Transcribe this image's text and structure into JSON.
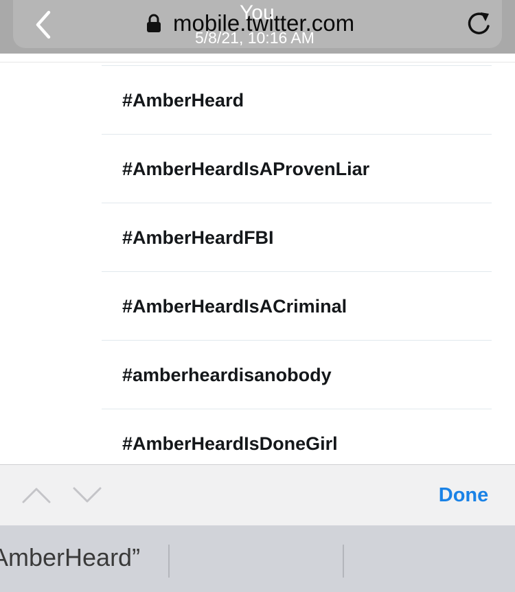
{
  "browser": {
    "url": "mobile.twitter.com",
    "overlay_user": "You",
    "overlay_datetime": "5/8/21, 10:16 AM",
    "icons": {
      "back": "chevron-left-icon",
      "secure": "lock-icon",
      "reload": "reload-icon"
    }
  },
  "results": {
    "items": [
      {
        "label": "#AmberHeard"
      },
      {
        "label": "#AmberHeardIsAProvenLiar"
      },
      {
        "label": "#AmberHeardFBI"
      },
      {
        "label": "#AmberHeardIsACriminal"
      },
      {
        "label": "#amberheardisanobody"
      },
      {
        "label": "#AmberHeardIsDoneGirl"
      }
    ]
  },
  "find_bar": {
    "done_label": "Done",
    "icons": {
      "previous": "chevron-up-icon",
      "next": "chevron-down-icon"
    }
  },
  "keyboard": {
    "suggestions": [
      "AmberHeard”",
      "",
      ""
    ]
  },
  "colors": {
    "accent": "#1a82e6",
    "topbar": "#a9a9a9",
    "address_pill": "#b6b6b6",
    "text": "#14171a",
    "find_bar": "#f1f1f2",
    "suggestion_bar": "#d1d3d9"
  }
}
